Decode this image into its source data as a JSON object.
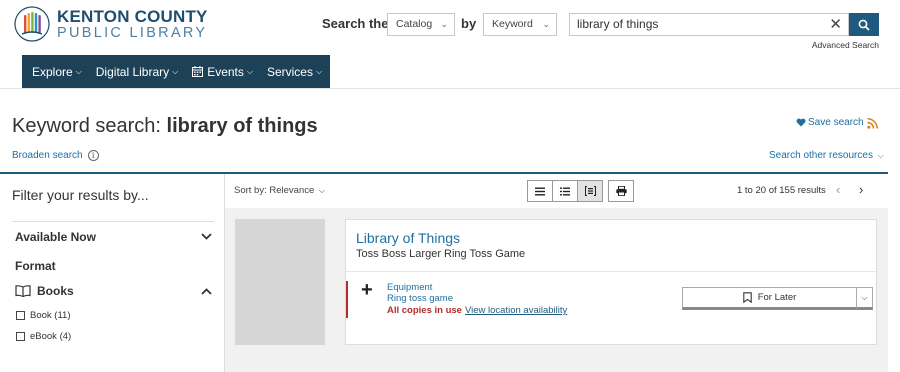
{
  "header": {
    "logo_line1": "KENTON COUNTY",
    "logo_line2": "PUBLIC LIBRARY",
    "search_label": "Search the",
    "by_label": "by",
    "catalog_select": "Catalog",
    "keyword_select": "Keyword",
    "search_value": "library of things",
    "advanced_search": "Advanced Search",
    "colors": {
      "navy": "#1d4258",
      "accent": "#1e6fa0"
    }
  },
  "nav": {
    "items": [
      {
        "label": "Explore",
        "icon": ""
      },
      {
        "label": "Digital Library",
        "icon": ""
      },
      {
        "label": "Events",
        "icon": "calendar-icon"
      },
      {
        "label": "Services",
        "icon": ""
      }
    ]
  },
  "title_area": {
    "prefix": "Keyword search: ",
    "query": "library of things",
    "save_search": "Save search",
    "broaden": "Broaden search",
    "other_resources": "Search other resources"
  },
  "sidebar": {
    "title": "Filter your results by...",
    "available_now": "Available Now",
    "format": "Format",
    "books": "Books",
    "options": [
      {
        "label": "Book (11)"
      },
      {
        "label": "eBook (4)"
      }
    ]
  },
  "toolbar": {
    "sort": "Sort by: Relevance",
    "pager": "1 to 20 of 155 results"
  },
  "record": {
    "title": "Library of Things",
    "subtitle": "Toss Boss Larger Ring Toss Game",
    "format_line1": "Equipment",
    "format_line2": "Ring toss game",
    "availability": "All copies in use",
    "location_link": "View location availability",
    "for_later": "For Later"
  }
}
